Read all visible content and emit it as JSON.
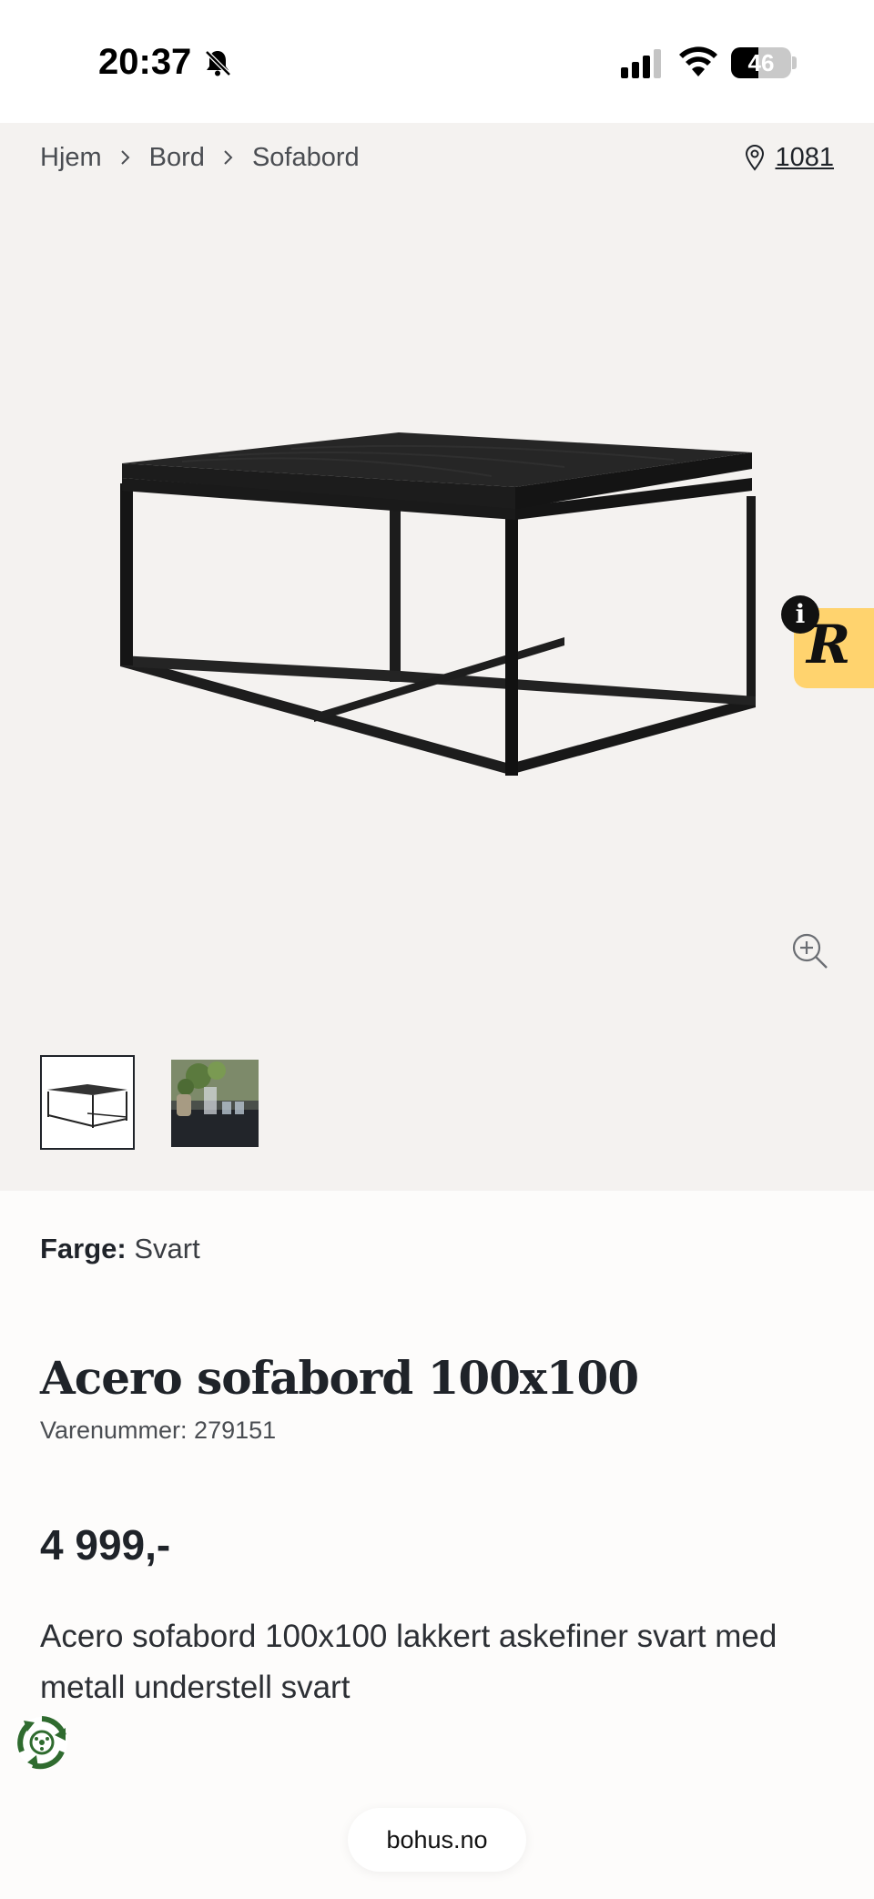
{
  "status_bar": {
    "time": "20:37",
    "battery": "46",
    "battery_level": 0.46,
    "icons": [
      "bell-slash-icon",
      "cellular-signal-icon",
      "wifi-icon",
      "battery-icon"
    ]
  },
  "breadcrumb": {
    "items": [
      "Hjem",
      "Bord",
      "Sofabord"
    ]
  },
  "store": {
    "postal_code": "1081",
    "icon": "map-pin-icon"
  },
  "gallery": {
    "zoom_icon": "zoom-in-icon",
    "thumbnails": [
      "table-product-photo",
      "lifestyle-photo"
    ]
  },
  "product": {
    "color_label": "Farge:",
    "color_value": "Svart",
    "title": "Acero sofabord 100x100",
    "sku": "Varenummer: 279151",
    "price": "4 999,-",
    "description": "Acero sofabord 100x100 lakkert askefiner svart med metall understell svart"
  },
  "colors": {
    "page_bg": "#fdfcfb",
    "gallery_bg": "#f4f2f0",
    "text": "#1f2329",
    "badge_yellow": "#ffd36e",
    "eco_green": "#2f6b2f"
  },
  "browser": {
    "url": "bohus.no"
  }
}
